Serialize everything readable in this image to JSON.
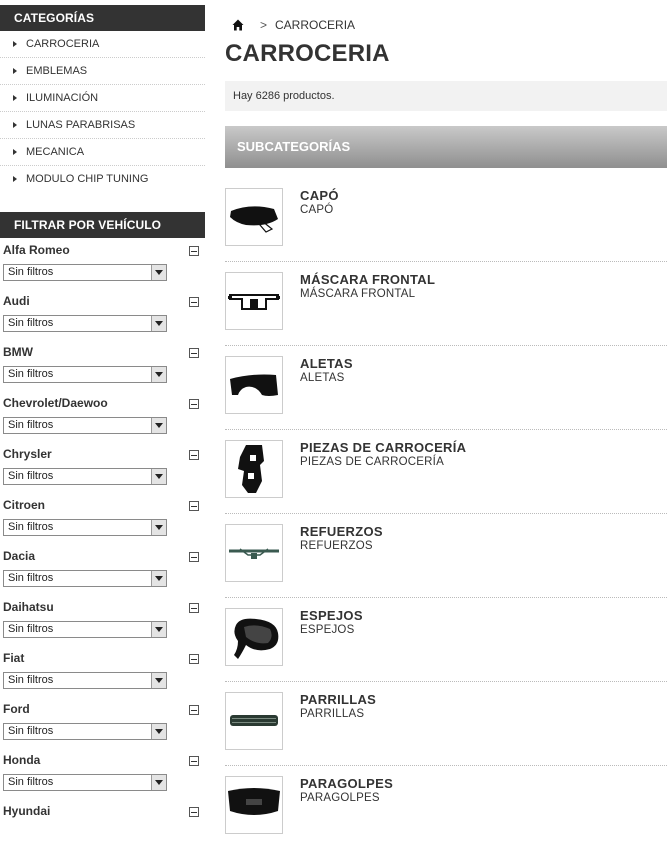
{
  "sidebar": {
    "categories_title": "CATEGORÍAS",
    "categories": [
      {
        "label": "CARROCERIA"
      },
      {
        "label": "EMBLEMAS"
      },
      {
        "label": "ILUMINACIÓN"
      },
      {
        "label": "LUNAS PARABRISAS"
      },
      {
        "label": "MECANICA"
      },
      {
        "label": "MODULO CHIP TUNING"
      }
    ],
    "filter_title": "FILTRAR POR VEHÍCULO",
    "vehicles": [
      {
        "name": "Alfa Romeo",
        "selected": "Sin filtros"
      },
      {
        "name": "Audi",
        "selected": "Sin filtros"
      },
      {
        "name": "BMW",
        "selected": "Sin filtros"
      },
      {
        "name": "Chevrolet/Daewoo",
        "selected": "Sin filtros"
      },
      {
        "name": "Chrysler",
        "selected": "Sin filtros"
      },
      {
        "name": "Citroen",
        "selected": "Sin filtros"
      },
      {
        "name": "Dacia",
        "selected": "Sin filtros"
      },
      {
        "name": "Daihatsu",
        "selected": "Sin filtros"
      },
      {
        "name": "Fiat",
        "selected": "Sin filtros"
      },
      {
        "name": "Ford",
        "selected": "Sin filtros"
      },
      {
        "name": "Honda",
        "selected": "Sin filtros"
      },
      {
        "name": "Hyundai",
        "selected": ""
      }
    ]
  },
  "breadcrumb": {
    "separator": ">",
    "current": "CARROCERIA"
  },
  "page_title": "CARROCERIA",
  "product_count_text": "Hay 6286 productos.",
  "subcategories_title": "SUBCATEGORÍAS",
  "subcategories": [
    {
      "name": "CAPÓ",
      "desc": "CAPÓ",
      "icon": "hood-icon"
    },
    {
      "name": "MÁSCARA FRONTAL",
      "desc": "MÁSCARA FRONTAL",
      "icon": "front-panel-icon"
    },
    {
      "name": "ALETAS",
      "desc": "ALETAS",
      "icon": "fender-icon"
    },
    {
      "name": "PIEZAS DE CARROCERÍA",
      "desc": "PIEZAS DE CARROCERÍA",
      "icon": "body-part-icon"
    },
    {
      "name": "REFUERZOS",
      "desc": "REFUERZOS",
      "icon": "reinforcement-icon"
    },
    {
      "name": "ESPEJOS",
      "desc": "ESPEJOS",
      "icon": "mirror-icon"
    },
    {
      "name": "PARRILLAS",
      "desc": "PARRILLAS",
      "icon": "grille-icon"
    },
    {
      "name": "PARAGOLPES",
      "desc": "PARAGOLPES",
      "icon": "bumper-icon"
    }
  ]
}
